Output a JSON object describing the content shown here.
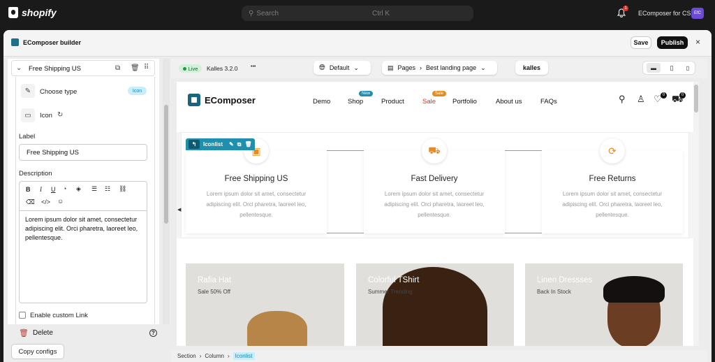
{
  "topbar": {
    "brand": "shopify",
    "search_placeholder": "Search",
    "search_shortcut": "Ctrl K",
    "notification_count": "1",
    "store_name": "EComposer for CS",
    "avatar_initials": "EfC"
  },
  "window": {
    "title": "EComposer builder",
    "save_label": "Save",
    "publish_label": "Publish",
    "close_glyph": "×"
  },
  "panel": {
    "item_title": "Free Shipping US",
    "choose_type_label": "Choose type",
    "type_value": "Icon",
    "icon_label": "Icon",
    "label_heading": "Label",
    "label_value": "Free Shipping US",
    "description_heading": "Description",
    "description_text": "Lorem ipsum dolor sit amet, consectetur adipiscing elit. Orci pharetra, laoreet leo, pellentesque.",
    "custom_link_label": "Enable custom Link",
    "delete_label": "Delete",
    "help_glyph": "?",
    "copy_label": "Copy configs"
  },
  "canvas_toolbar": {
    "live_label": "Live",
    "theme_version": "Kalles 3.2.0",
    "more_glyph": "•••",
    "view_label": "Default",
    "pages_label": "Pages",
    "page_name": "Best landing page",
    "theme_logo": "kalles"
  },
  "site": {
    "brand": "EComposer",
    "nav": [
      {
        "label": "Demo"
      },
      {
        "label": "Shop",
        "badge": "New"
      },
      {
        "label": "Product"
      },
      {
        "label": "Sale",
        "badge": "Sale"
      },
      {
        "label": "Portfolio"
      },
      {
        "label": "About us"
      },
      {
        "label": "FAQs"
      }
    ],
    "wishlist_count": "0",
    "cart_count": "0"
  },
  "iconlist": {
    "tool_label": "Iconlist",
    "items": [
      {
        "title": "Free Shipping US",
        "desc": "Lorem ipsum dolor sit amet, consectetur adipiscing elit. Orci pharetra, laoreet leo, pellentesque.",
        "icon": "box-icon"
      },
      {
        "title": "Fast Delivery",
        "desc": "Lorem ipsum dolor sit amet, consectetur adipiscing elit. Orci pharetra, laoreet leo, pellentesque.",
        "icon": "truck-icon"
      },
      {
        "title": "Free Returns",
        "desc": "Lorem ipsum dolor sit amet, consectetur adipiscing elit. Orci pharetra, laoreet leo, pellentesque.",
        "icon": "refresh-icon"
      }
    ]
  },
  "products": [
    {
      "title": "Rafia Hat",
      "sub": "Sale 50% Off"
    },
    {
      "title": "Colorful TShirt",
      "sub": "Summer Trending"
    },
    {
      "title": "Linen Dressses",
      "sub": "Back In Stock"
    }
  ],
  "breadcrumb": [
    "Section",
    "Column",
    "Iconlist"
  ],
  "colors": {
    "accent": "#1f8fad",
    "icon_orange": "#e98b1c",
    "publish_bg": "#111111"
  }
}
